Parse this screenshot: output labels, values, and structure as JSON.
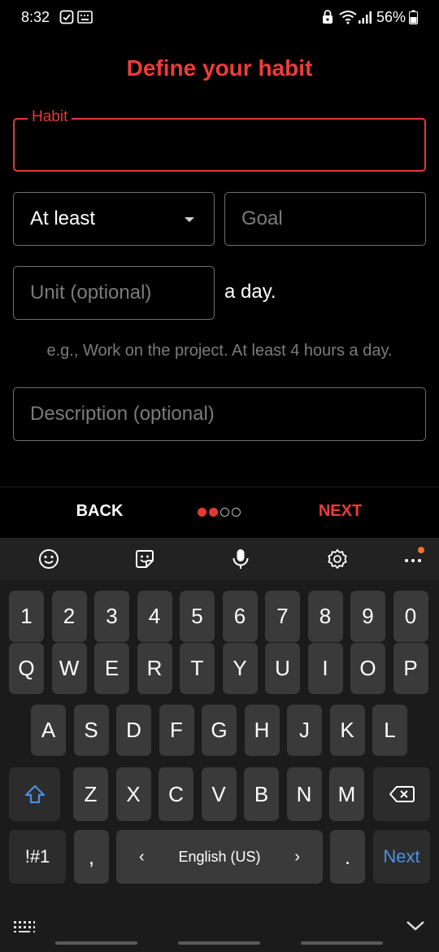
{
  "status_bar": {
    "time": "8:32",
    "battery_percent": "56%",
    "icons": [
      "check-box-icon",
      "keyboard-status-icon",
      "lock-icon",
      "wifi-icon",
      "signal-icon",
      "battery-icon"
    ]
  },
  "title": "Define your habit",
  "form": {
    "habit_label": "Habit",
    "habit_value": "",
    "comparator": "At least",
    "goal_placeholder": "Goal",
    "unit_placeholder": "Unit (optional)",
    "suffix": "a day.",
    "hint": "e.g., Work on the project. At least 4 hours a day.",
    "description_placeholder": "Description (optional)"
  },
  "navigation": {
    "back_label": "BACK",
    "next_label": "NEXT",
    "step_current": 2,
    "step_total": 4
  },
  "keyboard": {
    "toolbar_icons": [
      "emoji-icon",
      "sticker-icon",
      "microphone-icon",
      "settings-icon",
      "more-icon"
    ],
    "row_numbers": [
      "1",
      "2",
      "3",
      "4",
      "5",
      "6",
      "7",
      "8",
      "9",
      "0"
    ],
    "row1": [
      "Q",
      "W",
      "E",
      "R",
      "T",
      "Y",
      "U",
      "I",
      "O",
      "P"
    ],
    "row2": [
      "A",
      "S",
      "D",
      "F",
      "G",
      "H",
      "J",
      "K",
      "L"
    ],
    "row3": [
      "Z",
      "X",
      "C",
      "V",
      "B",
      "N",
      "M"
    ],
    "symbols_label": "!#1",
    "comma": ",",
    "language": "English (US)",
    "period": ".",
    "action_label": "Next"
  },
  "colors": {
    "accent": "#ef3b3b",
    "background": "#000000",
    "keyboard_key": "#3a3a3a",
    "action_blue": "#4a90e2",
    "notification_dot": "#f0752a"
  }
}
